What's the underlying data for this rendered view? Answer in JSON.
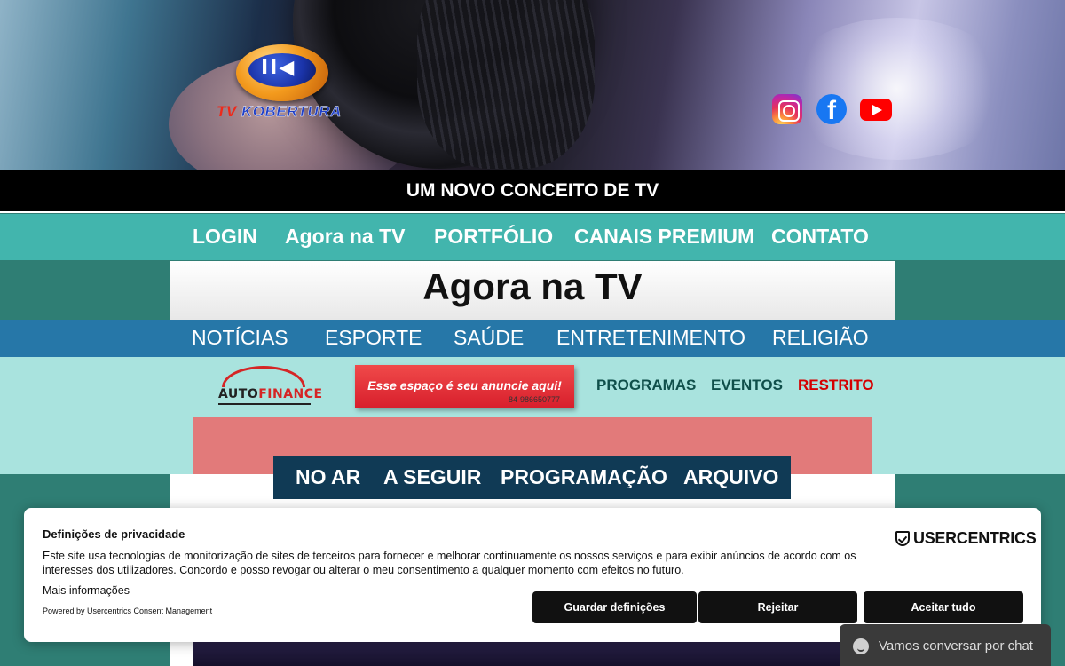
{
  "brand": {
    "logo_prefix": "TV",
    "logo_name": "KOBERTURA",
    "logo_glyph": "II◀"
  },
  "social": [
    {
      "icon": "instagram-icon"
    },
    {
      "icon": "facebook-icon",
      "glyph": "f"
    },
    {
      "icon": "youtube-icon"
    }
  ],
  "tagline": "UM NOVO CONCEITO DE TV",
  "main_nav": [
    "LOGIN",
    "Agora na TV",
    "PORTFÓLIO",
    "CANAIS PREMIUM",
    "CONTATO"
  ],
  "page_title": "Agora na TV",
  "category_nav": [
    "NOTÍCIAS",
    "ESPORTE",
    "SAÚDE",
    "ENTRETENIMENTO",
    "RELIGIÃO"
  ],
  "sponsor": {
    "name_a": "AUTO",
    "name_b": "FINANCE"
  },
  "ad": {
    "text": "Esse espaço é seu anuncie aqui!",
    "phone": "84-986650777"
  },
  "sub_nav": [
    {
      "label": "PROGRAMAS",
      "color": "#0f4f4a"
    },
    {
      "label": "EVENTOS",
      "color": "#0f4f4a"
    },
    {
      "label": "RESTRITO",
      "color": "#d40000"
    }
  ],
  "tabs": [
    "NO AR",
    "A SEGUIR",
    "PROGRAMAÇÃO",
    "ARQUIVO"
  ],
  "consent": {
    "title": "Definições de privacidade",
    "body": "Este site usa tecnologias de monitorização de sites de terceiros para fornecer e melhorar continuamente os nossos serviços e para exibir anúncios de acordo com os interesses dos utilizadores. Concordo e posso revogar ou alterar o meu consentimento a qualquer momento com efeitos no futuro.",
    "more_info": "Mais informações",
    "powered_by": "Powered by Usercentrics Consent Management",
    "provider_logo": "USERCENTRICS",
    "buttons": [
      "Guardar definições",
      "Rejeitar",
      "Aceitar tudo"
    ]
  },
  "chat": {
    "label": "Vamos conversar por chat"
  },
  "colors": {
    "teal_nav": "#42b5ad",
    "blue_nav": "#2677a8",
    "light_band": "#a9e3de",
    "tabs_bg": "#103a55",
    "ad_red": "#e02a34",
    "red_box": "#e27a7a"
  }
}
